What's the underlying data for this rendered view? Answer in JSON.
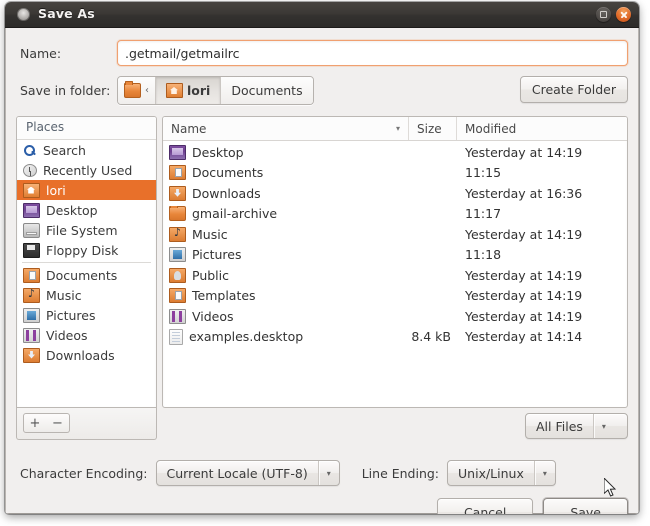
{
  "window": {
    "title": "Save As",
    "titlebar_icon": "app-dot-icon",
    "maximize_label": "",
    "close_label": ""
  },
  "name_row": {
    "label": "Name:",
    "value": ".getmail/getmailrc",
    "placeholder": ""
  },
  "folder_row": {
    "label": "Save in folder:",
    "breadcrumbs": [
      {
        "label": "‹",
        "icon": "chevron-left-icon",
        "active": false,
        "small": true
      },
      {
        "label": "lori",
        "icon": "home-folder-icon",
        "active": true,
        "small": false
      },
      {
        "label": "Documents",
        "icon": "",
        "active": false,
        "small": false
      }
    ],
    "create_folder_label": "Create Folder"
  },
  "places": {
    "header": "Places",
    "items": [
      {
        "label": "Search",
        "icon": "search-icon",
        "selected": false,
        "sep_after": false
      },
      {
        "label": "Recently Used",
        "icon": "recent-icon",
        "selected": false,
        "sep_after": false
      },
      {
        "label": "lori",
        "icon": "home-folder-icon",
        "selected": true,
        "sep_after": false
      },
      {
        "label": "Desktop",
        "icon": "desktop-icon",
        "selected": false,
        "sep_after": false
      },
      {
        "label": "File System",
        "icon": "filesystem-icon",
        "selected": false,
        "sep_after": false
      },
      {
        "label": "Floppy Disk",
        "icon": "floppy-icon",
        "selected": false,
        "sep_after": true
      },
      {
        "label": "Documents",
        "icon": "documents-folder-icon",
        "selected": false,
        "sep_after": false
      },
      {
        "label": "Music",
        "icon": "music-folder-icon",
        "selected": false,
        "sep_after": false
      },
      {
        "label": "Pictures",
        "icon": "pictures-folder-icon",
        "selected": false,
        "sep_after": false
      },
      {
        "label": "Videos",
        "icon": "videos-folder-icon",
        "selected": false,
        "sep_after": false
      },
      {
        "label": "Downloads",
        "icon": "downloads-folder-icon",
        "selected": false,
        "sep_after": false
      }
    ],
    "add_label": "+",
    "remove_label": "−"
  },
  "filelist": {
    "columns": {
      "name": "Name",
      "size": "Size",
      "modified": "Modified",
      "sort_indicator": "▾"
    },
    "rows": [
      {
        "name": "Desktop",
        "icon": "desktop-icon",
        "size": "",
        "modified": "Yesterday at 14:19"
      },
      {
        "name": "Documents",
        "icon": "documents-folder-icon",
        "size": "",
        "modified": "11:15"
      },
      {
        "name": "Downloads",
        "icon": "downloads-folder-icon",
        "size": "",
        "modified": "Yesterday at 16:36"
      },
      {
        "name": "gmail-archive",
        "icon": "folder-icon",
        "size": "",
        "modified": "11:17"
      },
      {
        "name": "Music",
        "icon": "music-folder-icon",
        "size": "",
        "modified": "Yesterday at 14:19"
      },
      {
        "name": "Pictures",
        "icon": "pictures-folder-icon",
        "size": "",
        "modified": "11:18"
      },
      {
        "name": "Public",
        "icon": "public-folder-icon",
        "size": "",
        "modified": "Yesterday at 14:19"
      },
      {
        "name": "Templates",
        "icon": "templates-folder-icon",
        "size": "",
        "modified": "Yesterday at 14:19"
      },
      {
        "name": "Videos",
        "icon": "videos-folder-icon",
        "size": "",
        "modified": "Yesterday at 14:19"
      },
      {
        "name": "examples.desktop",
        "icon": "text-file-icon",
        "size": "8.4 kB",
        "modified": "Yesterday at 14:14"
      }
    ]
  },
  "filter": {
    "value": "All Files",
    "arrow": "▾"
  },
  "encoding": {
    "char_label": "Character Encoding:",
    "char_value": "Current Locale (UTF-8)",
    "line_label": "Line Ending:",
    "line_value": "Unix/Linux",
    "arrow": "▾"
  },
  "actions": {
    "cancel": "Cancel",
    "save": "Save"
  },
  "colors": {
    "selection": "#e8702a",
    "focus_border": "#f0a070",
    "titlebar": "#3b3835",
    "close_button": "#e06a28",
    "dialog_bg": "#f1efee"
  }
}
